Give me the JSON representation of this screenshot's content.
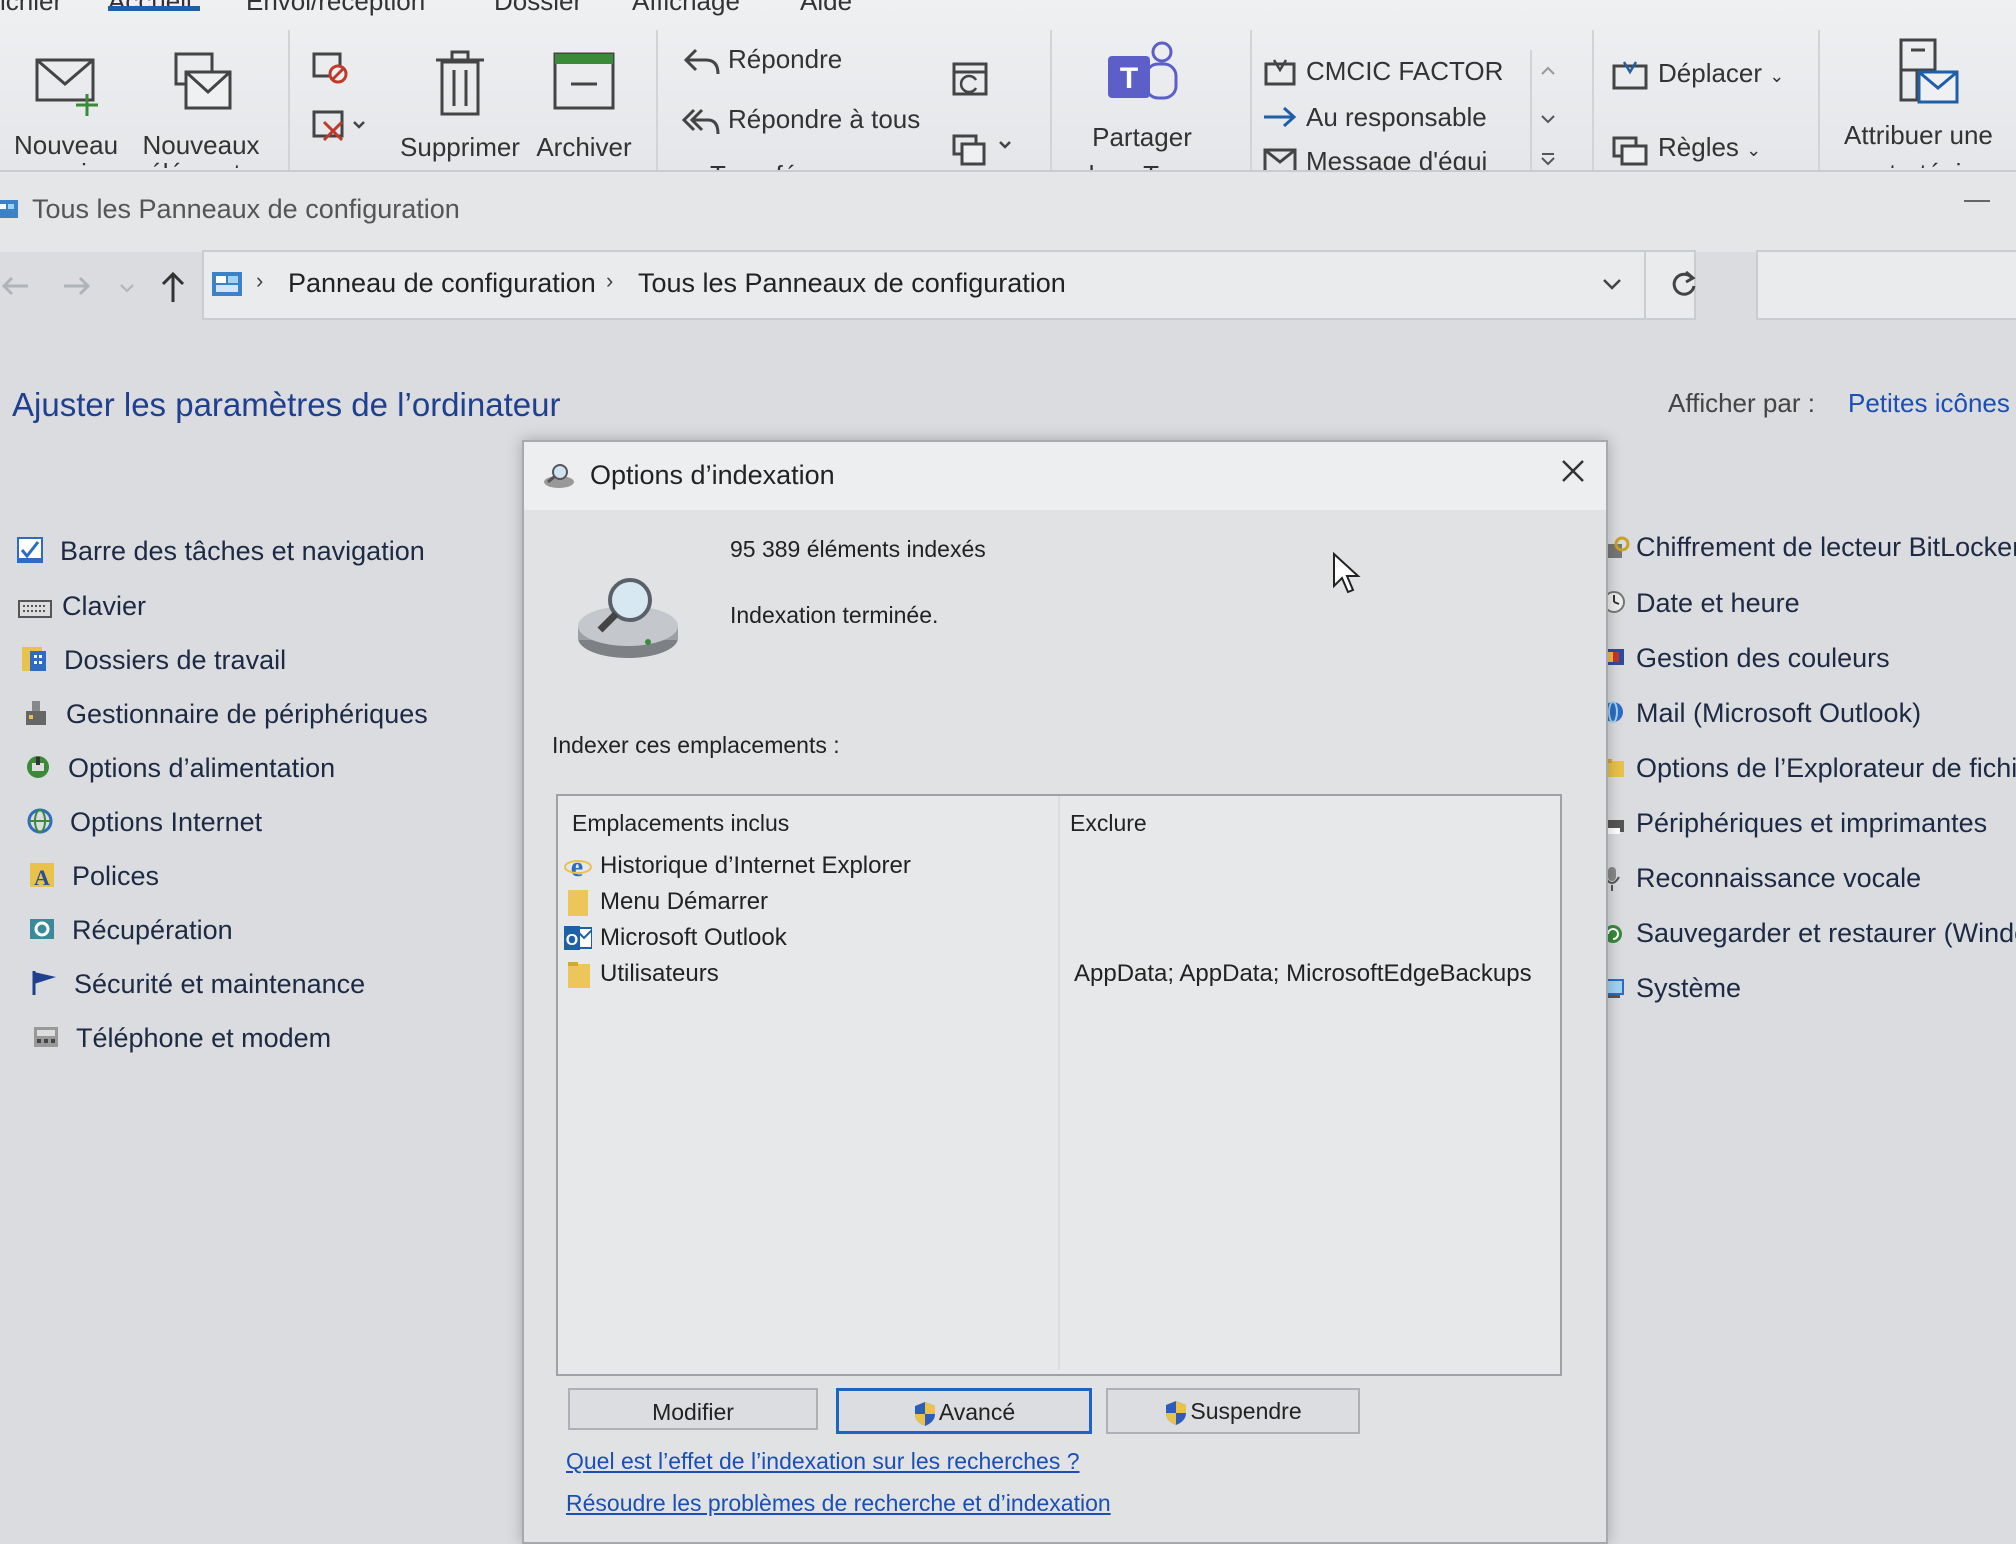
{
  "ribbon": {
    "tabs": [
      "ichier",
      "Accueil",
      "Envoi/réception",
      "Dossier",
      "Affichage",
      "Aide"
    ],
    "new_mail": "Nouveau",
    "new_mail_line2": "courrier",
    "new_items": "Nouveaux",
    "new_items_line2": "éléments",
    "delete": "Supprimer",
    "archive": "Archiver",
    "reply": "Répondre",
    "reply_all": "Répondre à tous",
    "forward_cut": "Transférer",
    "share_teams": "Partager",
    "share_teams_line2": "dans Teams",
    "quick_steps": [
      "CMCIC FACTOR",
      "Au responsable",
      "Message d'équi"
    ],
    "move": "Déplacer",
    "rules": "Règles",
    "assign_policy": "Attribuer une",
    "assign_policy_line2": "stratégie"
  },
  "cp": {
    "window_title": "Tous les Panneaux de configuration",
    "breadcrumb": [
      "Panneau de configuration",
      "Tous les Panneaux de configuration"
    ],
    "heading": "Ajuster les paramètres de l’ordinateur",
    "view_by_label": "Afficher par :",
    "view_by_value": "Petites icônes",
    "left_items": [
      "Barre des tâches et navigation",
      "Clavier",
      "Dossiers de travail",
      "Gestionnaire de périphériques",
      "Options d’alimentation",
      "Options Internet",
      "Polices",
      "Récupération",
      "Sécurité et maintenance",
      "Téléphone et modem"
    ],
    "right_items": [
      "Chiffrement de lecteur BitLocker",
      "Date et heure",
      "Gestion des couleurs",
      "Mail (Microsoft Outlook)",
      "Options de l’Explorateur de fichie",
      "Périphériques et imprimantes",
      "Reconnaissance vocale",
      "Sauvegarder et restaurer (Window",
      "Système"
    ]
  },
  "dialog": {
    "title": "Options d’indexation",
    "items_indexed": "95 389 éléments indexés",
    "status": "Indexation terminée.",
    "locations_label": "Indexer ces emplacements :",
    "col_included": "Emplacements inclus",
    "col_exclude": "Exclure",
    "rows": [
      {
        "name": "Historique d’Internet Explorer",
        "exclude": ""
      },
      {
        "name": "Menu Démarrer",
        "exclude": ""
      },
      {
        "name": "Microsoft Outlook",
        "exclude": ""
      },
      {
        "name": "Utilisateurs",
        "exclude": "AppData; AppData; MicrosoftEdgeBackups"
      }
    ],
    "btn_modify": "Modifier",
    "btn_advanced": "Avancé",
    "btn_pause": "Suspendre",
    "link_effect": "Quel est l’effet de l’indexation sur les recherches ?",
    "link_troubleshoot": "Résoudre les problèmes de recherche et d’indexation"
  },
  "colors": {
    "accent_link": "#1a4fb5",
    "heading_blue": "#1f3f8f",
    "primary_button_border": "#1d64c4"
  }
}
